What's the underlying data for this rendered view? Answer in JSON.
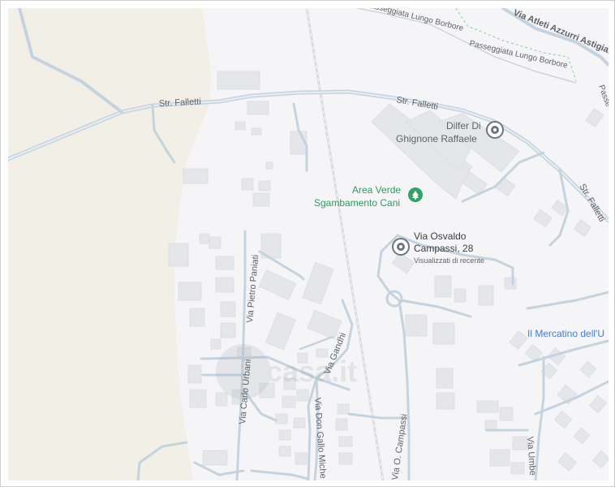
{
  "map": {
    "roads": {
      "str_falletti_west": "Str. Falletti",
      "str_falletti_mid": "Str. Falletti",
      "str_falletti_east": "Str. Falletti",
      "via_atleti": "Via Atleti Azzurri Astigiani",
      "lungo_borbore": "Passeggiata Lungo Borbore",
      "lungo_borbore_2": "Passeggiata Lungo Borbore",
      "passeggiata_edge": "Passe",
      "via_pietro_paniati": "Via Pietro Paniati",
      "via_carlo_urbani": "Via Carlo Urbani",
      "via_gandhi": "Via Gandhi",
      "via_don_gallo": "Via Don Gallo Miche",
      "via_campassi": "Via O. Campassi",
      "via_umberto": "Via Umbe"
    },
    "places": {
      "dilfer": {
        "line1": "Dilfer Di",
        "line2": "Ghignone Raffaele"
      },
      "area_verde": {
        "line1": "Area Verde",
        "line2": "Sgambamento Cani"
      },
      "selected": {
        "line1": "Via Osvaldo",
        "line2": "Campassi, 28",
        "note": "Visualizzati di recente"
      },
      "mercatino": "Il Mercatino dell'U"
    },
    "watermark": "casa.it",
    "colors": {
      "background": "#f5f5f7",
      "fields": "#f2efe6",
      "roads": "#c5d3de",
      "buildings": "#e4e6ea",
      "park_label": "#2e9b5f",
      "blue_label": "#3b7fe0",
      "pin": "#6b7680"
    }
  }
}
